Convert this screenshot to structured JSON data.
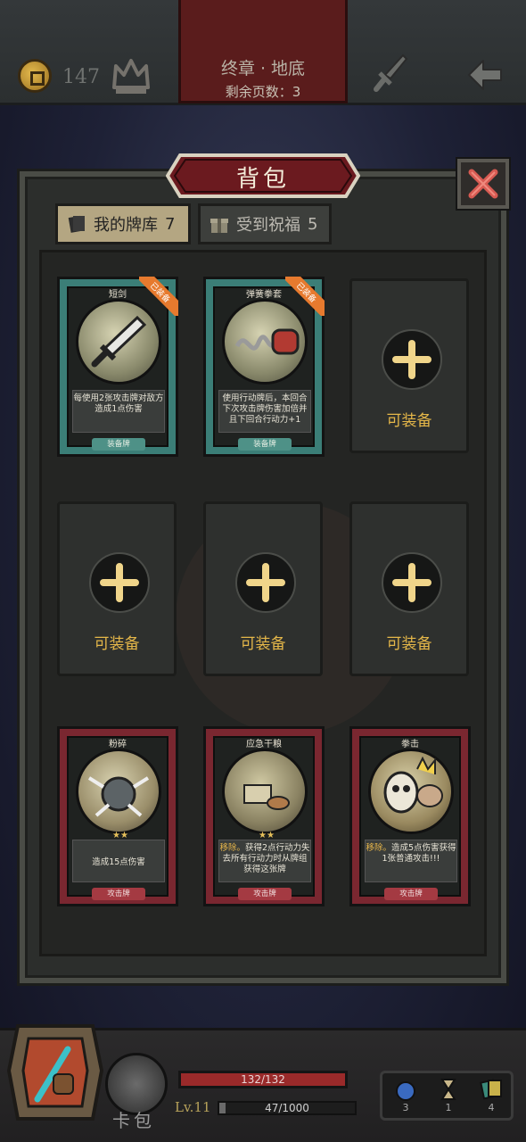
{
  "topbar": {
    "coins": "147",
    "chapter_title": "终章 · 地底",
    "pages_left": "剩余页数：3"
  },
  "panel": {
    "title": "背包",
    "tabs": [
      {
        "label": "我的牌库",
        "count": "7",
        "active": true
      },
      {
        "label": "受到祝福",
        "count": "5",
        "active": false
      }
    ]
  },
  "equipped": [
    {
      "name": "短剑",
      "badge": "已装备",
      "desc": "每使用2张攻击牌对敌方造成1点伤害",
      "type": "装备牌",
      "icon": "dagger"
    },
    {
      "name": "弹簧拳套",
      "badge": "已装备",
      "desc": "使用行动牌后，本回合下次攻击牌伤害加倍并且下回合行动力+1",
      "type": "装备牌",
      "icon": "spring-glove"
    }
  ],
  "empty_slot_label": "可装备",
  "cards": [
    {
      "name": "粉碎",
      "stars": "★★",
      "desc_hl": "",
      "desc": "造成15点伤害",
      "type": "攻击牌",
      "icon": "smash"
    },
    {
      "name": "应急干粮",
      "stars": "★★",
      "desc_hl": "移除。",
      "desc": "获得2点行动力失去所有行动力时从牌组获得这张牌",
      "type": "攻击牌",
      "icon": "ration"
    },
    {
      "name": "拳击",
      "stars": "",
      "desc_hl": "移除。",
      "desc": "造成5点伤害获得1张普通攻击!!!",
      "type": "攻击牌",
      "icon": "punch"
    }
  ],
  "bottombar": {
    "pack_label": "卡包",
    "hp": "132/132",
    "hp_fraction": 1.0,
    "level": "Lv.11",
    "xp": "47/1000",
    "xp_fraction": 0.047,
    "resources": [
      {
        "icon": "bomb-icon",
        "value": "3"
      },
      {
        "icon": "hourglass-icon",
        "value": "1"
      },
      {
        "icon": "cards-icon",
        "value": "4"
      }
    ]
  },
  "colors": {
    "equipped_card": "#3b7e77",
    "attack_card": "#7a2730",
    "equip_badge": "#e77a2e",
    "accent_gold": "#e5b749"
  }
}
